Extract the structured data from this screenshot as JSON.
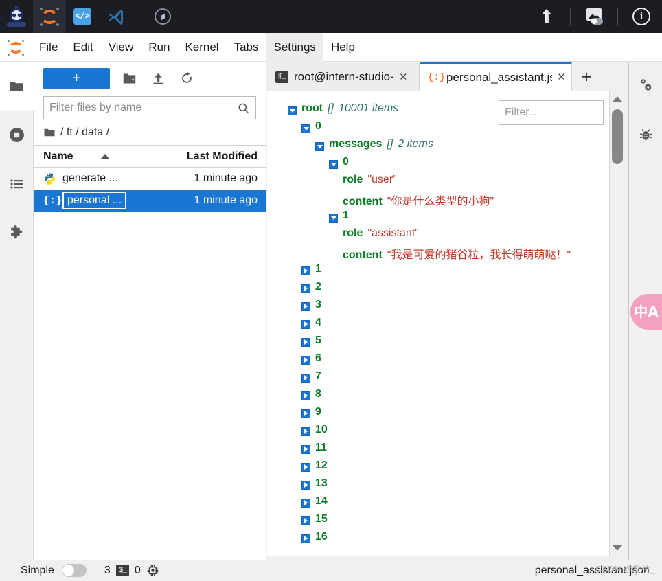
{
  "topbar": {
    "icons": [
      {
        "name": "openxlab-logo-icon",
        "label": "OpenXLab"
      },
      {
        "name": "jupyter-logo-icon",
        "label": "Jupyter"
      },
      {
        "name": "code-server-icon",
        "label": "Code Server"
      },
      {
        "name": "vscode-icon",
        "label": "VS Code"
      },
      {
        "name": "compass-icon",
        "label": "Compass"
      },
      {
        "name": "upload-arrow-icon",
        "label": "Upload"
      },
      {
        "name": "image-toggle-icon",
        "label": "Image"
      },
      {
        "name": "info-icon",
        "label": "Info"
      }
    ]
  },
  "menubar": {
    "logo": "jupyter-logo-icon",
    "items": [
      {
        "label": "File",
        "highlighted": false
      },
      {
        "label": "Edit",
        "highlighted": false
      },
      {
        "label": "View",
        "highlighted": false
      },
      {
        "label": "Run",
        "highlighted": false
      },
      {
        "label": "Kernel",
        "highlighted": false
      },
      {
        "label": "Tabs",
        "highlighted": false
      },
      {
        "label": "Settings",
        "highlighted": true
      },
      {
        "label": "Help",
        "highlighted": false
      }
    ]
  },
  "left_sidebar": {
    "items": [
      {
        "name": "file-browser",
        "icon": "folder-icon",
        "active": true
      },
      {
        "name": "running-terminals",
        "icon": "stop-circle-icon",
        "active": false
      },
      {
        "name": "table-of-contents",
        "icon": "list-icon",
        "active": false
      },
      {
        "name": "extension-manager",
        "icon": "puzzle-piece-icon",
        "active": false
      }
    ]
  },
  "right_sidebar": {
    "items": [
      {
        "name": "property-inspector",
        "icon": "gears-icon"
      },
      {
        "name": "debugger",
        "icon": "bug-icon"
      }
    ]
  },
  "file_browser": {
    "new_launcher_label": "+",
    "toolbar_buttons": [
      {
        "name": "new-folder-button",
        "icon": "new-folder-icon"
      },
      {
        "name": "upload-button",
        "icon": "upload-icon"
      },
      {
        "name": "refresh-button",
        "icon": "refresh-icon"
      }
    ],
    "filter": {
      "value": "",
      "placeholder": "Filter files by name",
      "icon": "search-icon"
    },
    "breadcrumb": "/ ft / data /",
    "columns": {
      "name": "Name",
      "last_modified": "Last Modified"
    },
    "sort": "ascending",
    "rows": [
      {
        "icon": "python-file-icon",
        "name": "generate ...",
        "modified": "1 minute ago",
        "selected": false,
        "editing": false
      },
      {
        "icon": "json-file-icon",
        "name": "personal ...",
        "modified": "1 minute ago",
        "selected": true,
        "editing": true
      }
    ]
  },
  "dock": {
    "tabs": [
      {
        "label": "root@intern-studio-",
        "icon": "terminal-icon",
        "active": false,
        "close": "×"
      },
      {
        "label": "personal_assistant.js‹",
        "icon": "json-file-icon",
        "active": true,
        "close": "×"
      }
    ],
    "new_tab_label": "+"
  },
  "json_viewer": {
    "filter": {
      "value": "",
      "placeholder": "Filter…",
      "icon": "search-icon"
    },
    "root": {
      "key": "root",
      "brackets": "[]",
      "items_label": "10001 items",
      "expanded": true
    },
    "entry_0": {
      "index": "0",
      "expanded": true,
      "messages": {
        "key": "messages",
        "brackets": "[]",
        "items_label": "2 items",
        "expanded": true,
        "list": [
          {
            "index": "0",
            "expanded": true,
            "role_key": "role",
            "role_value": "\"user\"",
            "content_key": "content",
            "content_value": "\"你是什么类型的小狗\""
          },
          {
            "index": "1",
            "expanded": true,
            "role_key": "role",
            "role_value": "\"assistant\"",
            "content_key": "content",
            "content_value": "\"我是可爱的猪谷粒，我长得萌萌哒！\""
          }
        ]
      }
    },
    "collapsed_entries": [
      "1",
      "2",
      "3",
      "4",
      "5",
      "6",
      "7",
      "8",
      "9",
      "10",
      "11",
      "12",
      "13",
      "14",
      "15",
      "16"
    ]
  },
  "translate_fab": {
    "name": "translate-button",
    "glyph": "中A"
  },
  "statusbar": {
    "simple_label": "Simple",
    "simple_enabled": false,
    "terminal_count": "3",
    "terminal_icon": "terminal-icon",
    "kernel_count": "0",
    "kernel_icon": "chip-icon",
    "filename": "personal_assistant.json",
    "watermark": "CSDN @发桥_"
  },
  "colors": {
    "accent_blue": "#1976d2",
    "jupyter_orange": "#f37726",
    "json_key_green": "#0a7d24",
    "json_string_red": "#c0392b",
    "json_meta_teal": "#2f6f6f",
    "topbar_dark": "#1b1d23",
    "translate_pink": "#f4a0c0"
  }
}
